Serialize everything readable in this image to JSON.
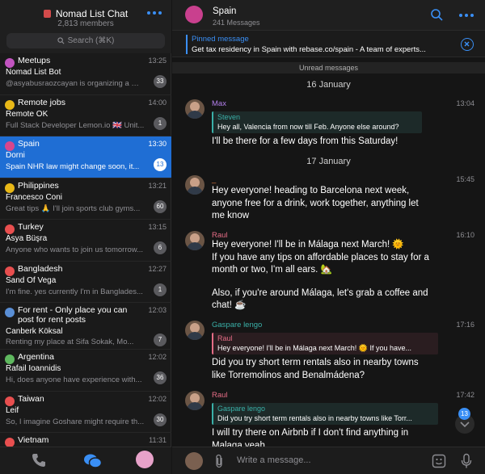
{
  "sidebar": {
    "title": "Nomad List Chat",
    "members": "2,813 members",
    "search_placeholder": "Search (⌘K)",
    "chats": [
      {
        "name": "Meetups",
        "sender": "Nomad List Bot",
        "message": "@asyabusraozcayan is organizing a meetup...",
        "time": "13:25",
        "badge": "33",
        "color": "#c254c0"
      },
      {
        "name": "Remote jobs",
        "sender": "Remote OK",
        "message": "Full Stack Developer Lemon.io 🇬🇧 Unit...",
        "time": "14:00",
        "badge": "1",
        "color": "#e8b817"
      },
      {
        "name": "Spain",
        "sender": "Dorni",
        "message": "Spain NHR law might change soon, it...",
        "time": "13:30",
        "badge": "13",
        "color": "#d9468c"
      },
      {
        "name": "Philippines",
        "sender": "Francesco Coni",
        "message": "Great tips 🙏 I'll join sports club gyms...",
        "time": "13:21",
        "badge": "60",
        "color": "#e8b817"
      },
      {
        "name": "Turkey",
        "sender": "Asya Büşra",
        "message": "Anyone who wants to join us tomorrow...",
        "time": "13:15",
        "badge": "6",
        "color": "#e84f4f"
      },
      {
        "name": "Bangladesh",
        "sender": "Sand Of Vega",
        "message": "I'm fine. yes currently I'm in Banglades...",
        "time": "12:27",
        "badge": "1",
        "color": "#e84f4f"
      },
      {
        "name": "For rent - Only place you can",
        "name2": "post for rent posts",
        "sender": "Canberk Köksal",
        "message": "Renting my place at Sifa Sokak, Mo...",
        "time": "12:03",
        "badge": "7",
        "color": "#5a8fd6"
      },
      {
        "name": "Argentina",
        "sender": "Rafail Ioannidis",
        "message": "Hi, does anyone have experience with...",
        "time": "12:02",
        "badge": "36",
        "color": "#5fb85f"
      },
      {
        "name": "Taiwan",
        "sender": "Leif",
        "message": "So, I imagine Goshare might require th...",
        "time": "12:02",
        "badge": "30",
        "color": "#e84f4f"
      },
      {
        "name": "Vietnam",
        "sender": "",
        "message": "",
        "time": "11:31",
        "badge": "",
        "color": "#e84f4f"
      }
    ]
  },
  "chat": {
    "title": "Spain",
    "subtitle": "241 Messages",
    "pinned_label": "Pinned message",
    "pinned_text": "Get tax residency in Spain with rebase.co/spain - A team of experts...",
    "unread_label": "Unread messages",
    "dates": [
      "16 January",
      "17 January"
    ],
    "messages": [
      {
        "sender": "Max",
        "sender_color": "#b37feb",
        "time": "13:04",
        "reply_name": "Steven",
        "reply_text": "Hey all, Valencia from now till Feb. Anyone else around?",
        "reply_color": "#3ab0a8",
        "lines": [
          "I'll be there for a few days from this Saturday!"
        ]
      },
      {
        "sender": "_",
        "sender_color": "#e0733a",
        "time": "15:45",
        "lines": [
          "Hey everyone! heading to Barcelona next week,",
          "anyone free for a drink, work together, anything let",
          "me know"
        ]
      },
      {
        "sender": "Raul",
        "sender_color": "#e56d86",
        "time": "16:10",
        "lines": [
          "Hey everyone! I'll be in Málaga next March! 🌞",
          "If you have any tips on affordable places to stay for a",
          "month or two, I'm all ears. 🏡",
          "",
          "Also, if you're around Málaga, let's grab a coffee and",
          "chat! ☕"
        ]
      },
      {
        "sender": "Gaspare lengo",
        "sender_color": "#3ab0a8",
        "time": "17:16",
        "reply_name": "Raul",
        "reply_text": "Hey everyone! I'll be in Málaga next March! 🌞  If you have...",
        "reply_color": "#e56d86",
        "lines": [
          "Did you try short term rentals also in nearby towns",
          "like Torremolinos and Benalmádena?"
        ]
      },
      {
        "sender": "Raul",
        "sender_color": "#e56d86",
        "time": "17:42",
        "reply_name": "Gaspare lengo",
        "reply_text": "Did you try short term rentals also in nearby towns like Torr...",
        "reply_color": "#3ab0a8",
        "lines": [
          "I will try there on Airbnb if I don't find anything in",
          "Malaga yeah"
        ]
      }
    ],
    "scroll_badge": "13",
    "input_placeholder": "Write a message..."
  }
}
